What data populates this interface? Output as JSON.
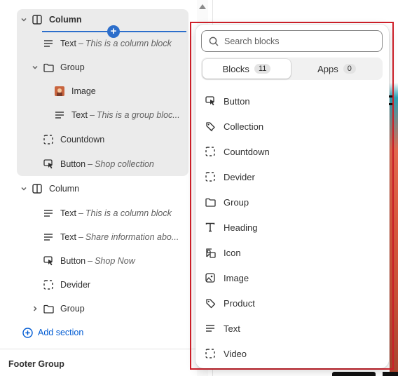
{
  "sidebar": {
    "rows": [
      {
        "label": "Column",
        "sub": "",
        "icon": "column-icon",
        "chevron": "down"
      },
      {
        "label": "Text",
        "sub": "This is a column block",
        "icon": "text-icon"
      },
      {
        "label": "Group",
        "sub": "",
        "icon": "folder-icon",
        "chevron": "down"
      },
      {
        "label": "Image",
        "sub": "",
        "icon": "image-thumbnail-icon"
      },
      {
        "label": "Text",
        "sub": "This is a group bloc...",
        "icon": "text-icon"
      },
      {
        "label": "Countdown",
        "sub": "",
        "icon": "dashed-square-icon"
      },
      {
        "label": "Button",
        "sub": "Shop collection",
        "icon": "cursor-click-icon"
      },
      {
        "label": "Column",
        "sub": "",
        "icon": "column-icon",
        "chevron": "down"
      },
      {
        "label": "Text",
        "sub": "This is a column block",
        "icon": "text-icon"
      },
      {
        "label": "Text",
        "sub": "Share information abo...",
        "icon": "text-icon"
      },
      {
        "label": "Button",
        "sub": "Shop Now",
        "icon": "cursor-click-icon"
      },
      {
        "label": "Devider",
        "sub": "",
        "icon": "dashed-square-icon"
      },
      {
        "label": "Group",
        "sub": "",
        "icon": "folder-icon",
        "chevron": "right"
      }
    ],
    "dash": "–",
    "add_section": "Add section",
    "footer_group": "Footer Group"
  },
  "popover": {
    "search_placeholder": "Search blocks",
    "tabs": [
      {
        "label": "Blocks",
        "count": "11",
        "active": true
      },
      {
        "label": "Apps",
        "count": "0",
        "active": false
      }
    ],
    "blocks": [
      {
        "label": "Button",
        "icon": "cursor-click-icon"
      },
      {
        "label": "Collection",
        "icon": "tags-icon"
      },
      {
        "label": "Countdown",
        "icon": "dashed-square-icon"
      },
      {
        "label": "Devider",
        "icon": "dashed-square-icon"
      },
      {
        "label": "Group",
        "icon": "folder-icon"
      },
      {
        "label": "Heading",
        "icon": "heading-t-icon"
      },
      {
        "label": "Icon",
        "icon": "image-shapes-icon"
      },
      {
        "label": "Image",
        "icon": "image-icon"
      },
      {
        "label": "Product",
        "icon": "tag-icon"
      },
      {
        "label": "Text",
        "icon": "text-icon"
      },
      {
        "label": "Video",
        "icon": "dashed-square-icon"
      }
    ]
  },
  "colors": {
    "accent": "#2c6ecb",
    "link": "#005bd3",
    "highlight_frame": "#d0202a",
    "selected_bg": "#ebebeb"
  }
}
